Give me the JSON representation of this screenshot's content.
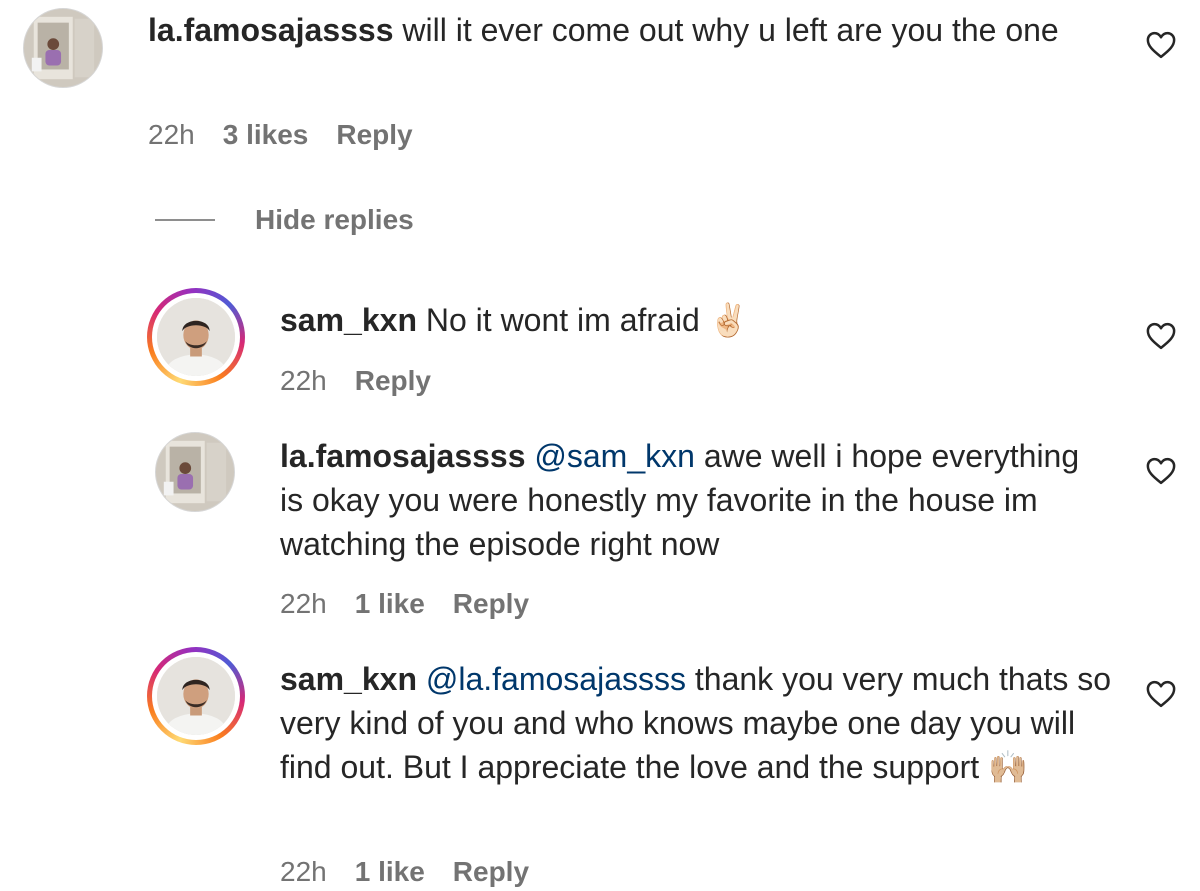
{
  "comments": [
    {
      "username": "la.famosajassss",
      "mention": "",
      "text": "will it ever come out why u left are you the one",
      "emoji": "",
      "time": "22h",
      "likes": "3 likes",
      "reply": "Reply",
      "avatar_icon": "mirror-selfie-avatar-icon"
    },
    {
      "username": "sam_kxn",
      "mention": "",
      "text": "No it wont im afraid",
      "emoji": "✌🏻",
      "time": "22h",
      "likes": "",
      "reply": "Reply",
      "avatar_icon": "portrait-avatar-icon"
    },
    {
      "username": "la.famosajassss",
      "mention": "@sam_kxn",
      "text": "awe well i hope everything is okay you were honestly my favorite in the house im watching the episode right now",
      "emoji": "",
      "time": "22h",
      "likes": "1 like",
      "reply": "Reply",
      "avatar_icon": "mirror-selfie-avatar-icon"
    },
    {
      "username": "sam_kxn",
      "mention": "@la.famosajassss",
      "text": "thank you very much thats so very kind of you and who knows maybe one day you will find out. But I appreciate the love and the support",
      "emoji": "🙌🏼",
      "time": "22h",
      "likes": "1 like",
      "reply": "Reply",
      "avatar_icon": "portrait-avatar-icon"
    }
  ],
  "hide_replies_label": "Hide replies",
  "icons": {
    "like": "heart-outline-icon"
  },
  "colors": {
    "text": "#262626",
    "muted": "#737373",
    "mention": "#00376b",
    "story_ring": [
      "#feda75",
      "#fa7e1e",
      "#d62976",
      "#962fbf",
      "#4f5bd5"
    ]
  }
}
